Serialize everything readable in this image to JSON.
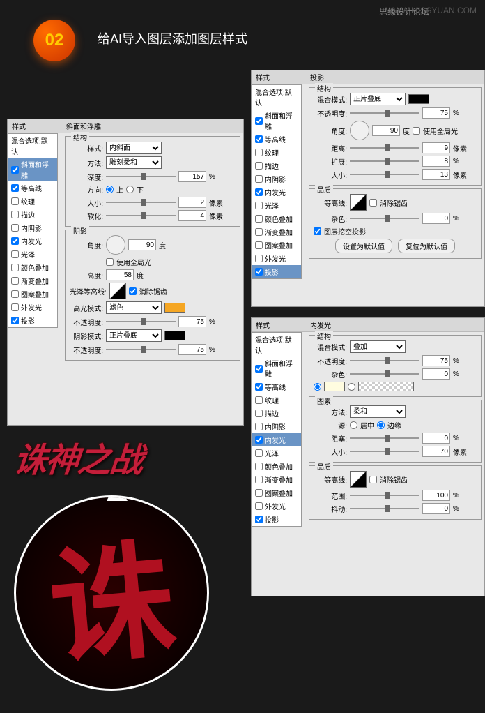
{
  "watermark": {
    "site": "WWW.MISSYUAN.COM",
    "forum": "思缘设计论坛"
  },
  "step": {
    "number": "02",
    "title": "给AI导入图层添加图层样式"
  },
  "styleItems": [
    "斜面和浮雕",
    "等高线",
    "纹理",
    "描边",
    "内阴影",
    "内发光",
    "光泽",
    "颜色叠加",
    "渐变叠加",
    "图案叠加",
    "外发光",
    "投影"
  ],
  "labels": {
    "styles": "样式",
    "blendDefault": "混合选项:默认",
    "bevel": "斜面和浮雕",
    "structure": "结构",
    "style": "样式:",
    "technique": "方法:",
    "depth": "深度:",
    "direction": "方向:",
    "up": "上",
    "down": "下",
    "size": "大小:",
    "soften": "软化:",
    "shading": "阴影",
    "angle": "角度:",
    "degree": "度",
    "useGlobal": "使用全局光",
    "altitude": "高度:",
    "glossContour": "光泽等高线:",
    "antiAlias": "消除锯齿",
    "highlightMode": "高光模式:",
    "opacity": "不透明度:",
    "shadowMode": "阴影模式:",
    "pixel": "像素",
    "percent": "%",
    "dropShadow": "投影",
    "blendMode": "混合模式:",
    "distance": "距离:",
    "spread": "扩展:",
    "quality": "品质",
    "contour": "等高线:",
    "noise": "杂色:",
    "knockout": "图层挖空投影",
    "makeDefault": "设置为默认值",
    "resetDefault": "复位为默认值",
    "innerGlow": "内发光",
    "elements": "图素",
    "source": "源:",
    "center": "居中",
    "edge": "边缘",
    "choke": "阻塞:",
    "range": "范围:",
    "jitter": "抖动:"
  },
  "panel1": {
    "style": "内斜面",
    "technique": "雕刻柔和",
    "depth": "157",
    "size": "2",
    "soften": "4",
    "angle": "90",
    "altitude": "58",
    "highlightMode": "滤色",
    "highlightOpacity": "75",
    "shadowMode": "正片叠底",
    "shadowOpacity": "75"
  },
  "panel2": {
    "blendMode": "正片叠底",
    "opacity": "75",
    "angle": "90",
    "distance": "9",
    "spread": "8",
    "size": "13"
  },
  "panel3": {
    "blendMode": "叠加",
    "opacity": "75",
    "noise": "0",
    "technique": "柔和",
    "choke": "0",
    "size": "70",
    "range": "100",
    "jitter": "0"
  },
  "artwork": {
    "text": "诛神之战"
  }
}
